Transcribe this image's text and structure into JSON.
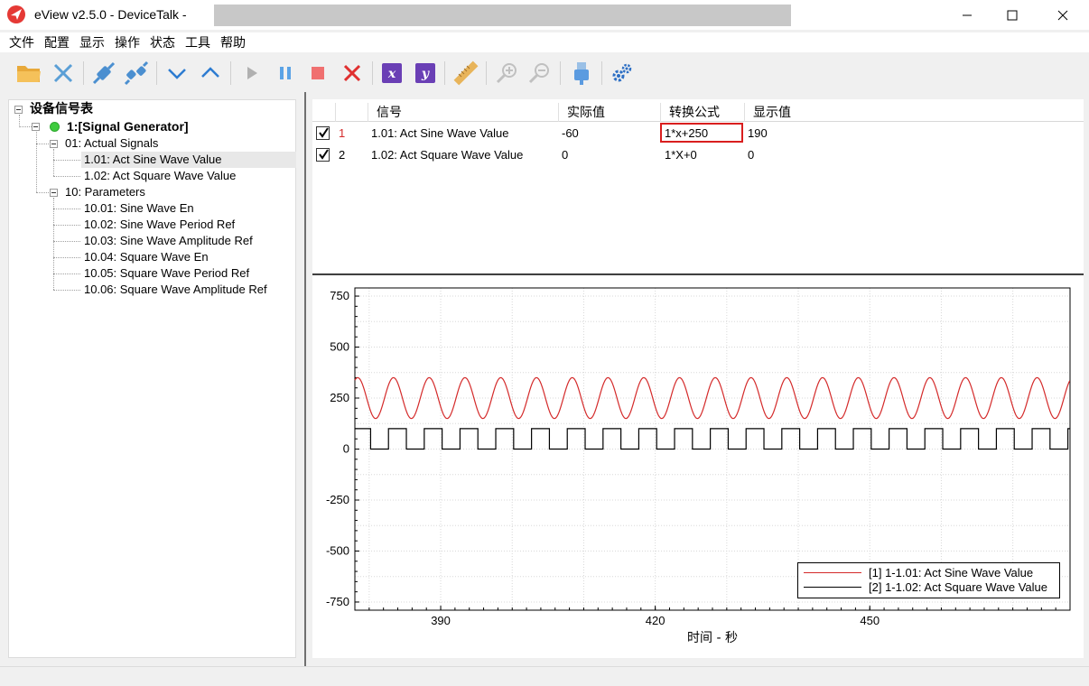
{
  "window": {
    "title": "eView v2.5.0 - DeviceTalk  -",
    "controls": [
      "minimize",
      "maximize",
      "close"
    ]
  },
  "menu": [
    "文件",
    "配置",
    "显示",
    "操作",
    "状态",
    "工具",
    "帮助"
  ],
  "toolbar": {
    "icons": [
      "open-folder-icon",
      "disconnect-icon",
      "connect-icon",
      "reconnect-icon",
      "collapse-down-icon",
      "expand-up-icon",
      "play-icon",
      "pause-icon",
      "stop-icon",
      "delete-icon",
      "x-axis-icon",
      "y-axis-icon",
      "ruler-icon",
      "zoom-in-icon",
      "zoom-out-icon",
      "usb-icon",
      "settings-icon"
    ],
    "x_label": "x",
    "y_label": "y"
  },
  "tree": {
    "root": "设备信号表",
    "device": "1:[Signal Generator]",
    "groups": [
      {
        "label": "01: Actual Signals",
        "items": [
          "1.01: Act Sine Wave Value",
          "1.02: Act Square Wave Value"
        ]
      },
      {
        "label": "10: Parameters",
        "items": [
          "10.01: Sine Wave En",
          "10.02: Sine Wave Period Ref",
          "10.03: Sine Wave Amplitude Ref",
          "10.04: Square Wave En",
          "10.05: Square Wave Period Ref",
          "10.06: Square Wave Amplitude Ref"
        ]
      }
    ],
    "selected": "1.01: Act Sine Wave Value"
  },
  "table": {
    "headers": [
      "信号",
      "实际值",
      "转换公式",
      "显示值"
    ],
    "rows": [
      {
        "checked": true,
        "index": "1",
        "signal": "1.01: Act Sine Wave Value",
        "actual": "-60",
        "formula": "1*x+250",
        "display": "190"
      },
      {
        "checked": true,
        "index": "2",
        "signal": "1.02: Act Square Wave Value",
        "actual": "0",
        "formula": "1*X+0",
        "display": "0"
      }
    ]
  },
  "chart_data": {
    "type": "line",
    "xlabel": "时间 - 秒",
    "ylabel": "",
    "xlim": [
      378,
      478
    ],
    "ylim": [
      -790,
      790
    ],
    "x_ticks": [
      390,
      420,
      450
    ],
    "y_ticks": [
      750,
      500,
      250,
      0,
      -250,
      -500,
      -750
    ],
    "grid": true,
    "legend_position": "bottom-right",
    "series": [
      {
        "name": "[1] 1-1.01: Act Sine Wave Value",
        "color": "#d42a2a",
        "kind": "sine",
        "offset": 250,
        "amplitude": 100,
        "period": 5
      },
      {
        "name": "[2] 1-1.02: Act Square Wave Value",
        "color": "#000000",
        "kind": "square",
        "low": 0,
        "high": 100,
        "period": 5,
        "duty": 0.5
      }
    ]
  }
}
